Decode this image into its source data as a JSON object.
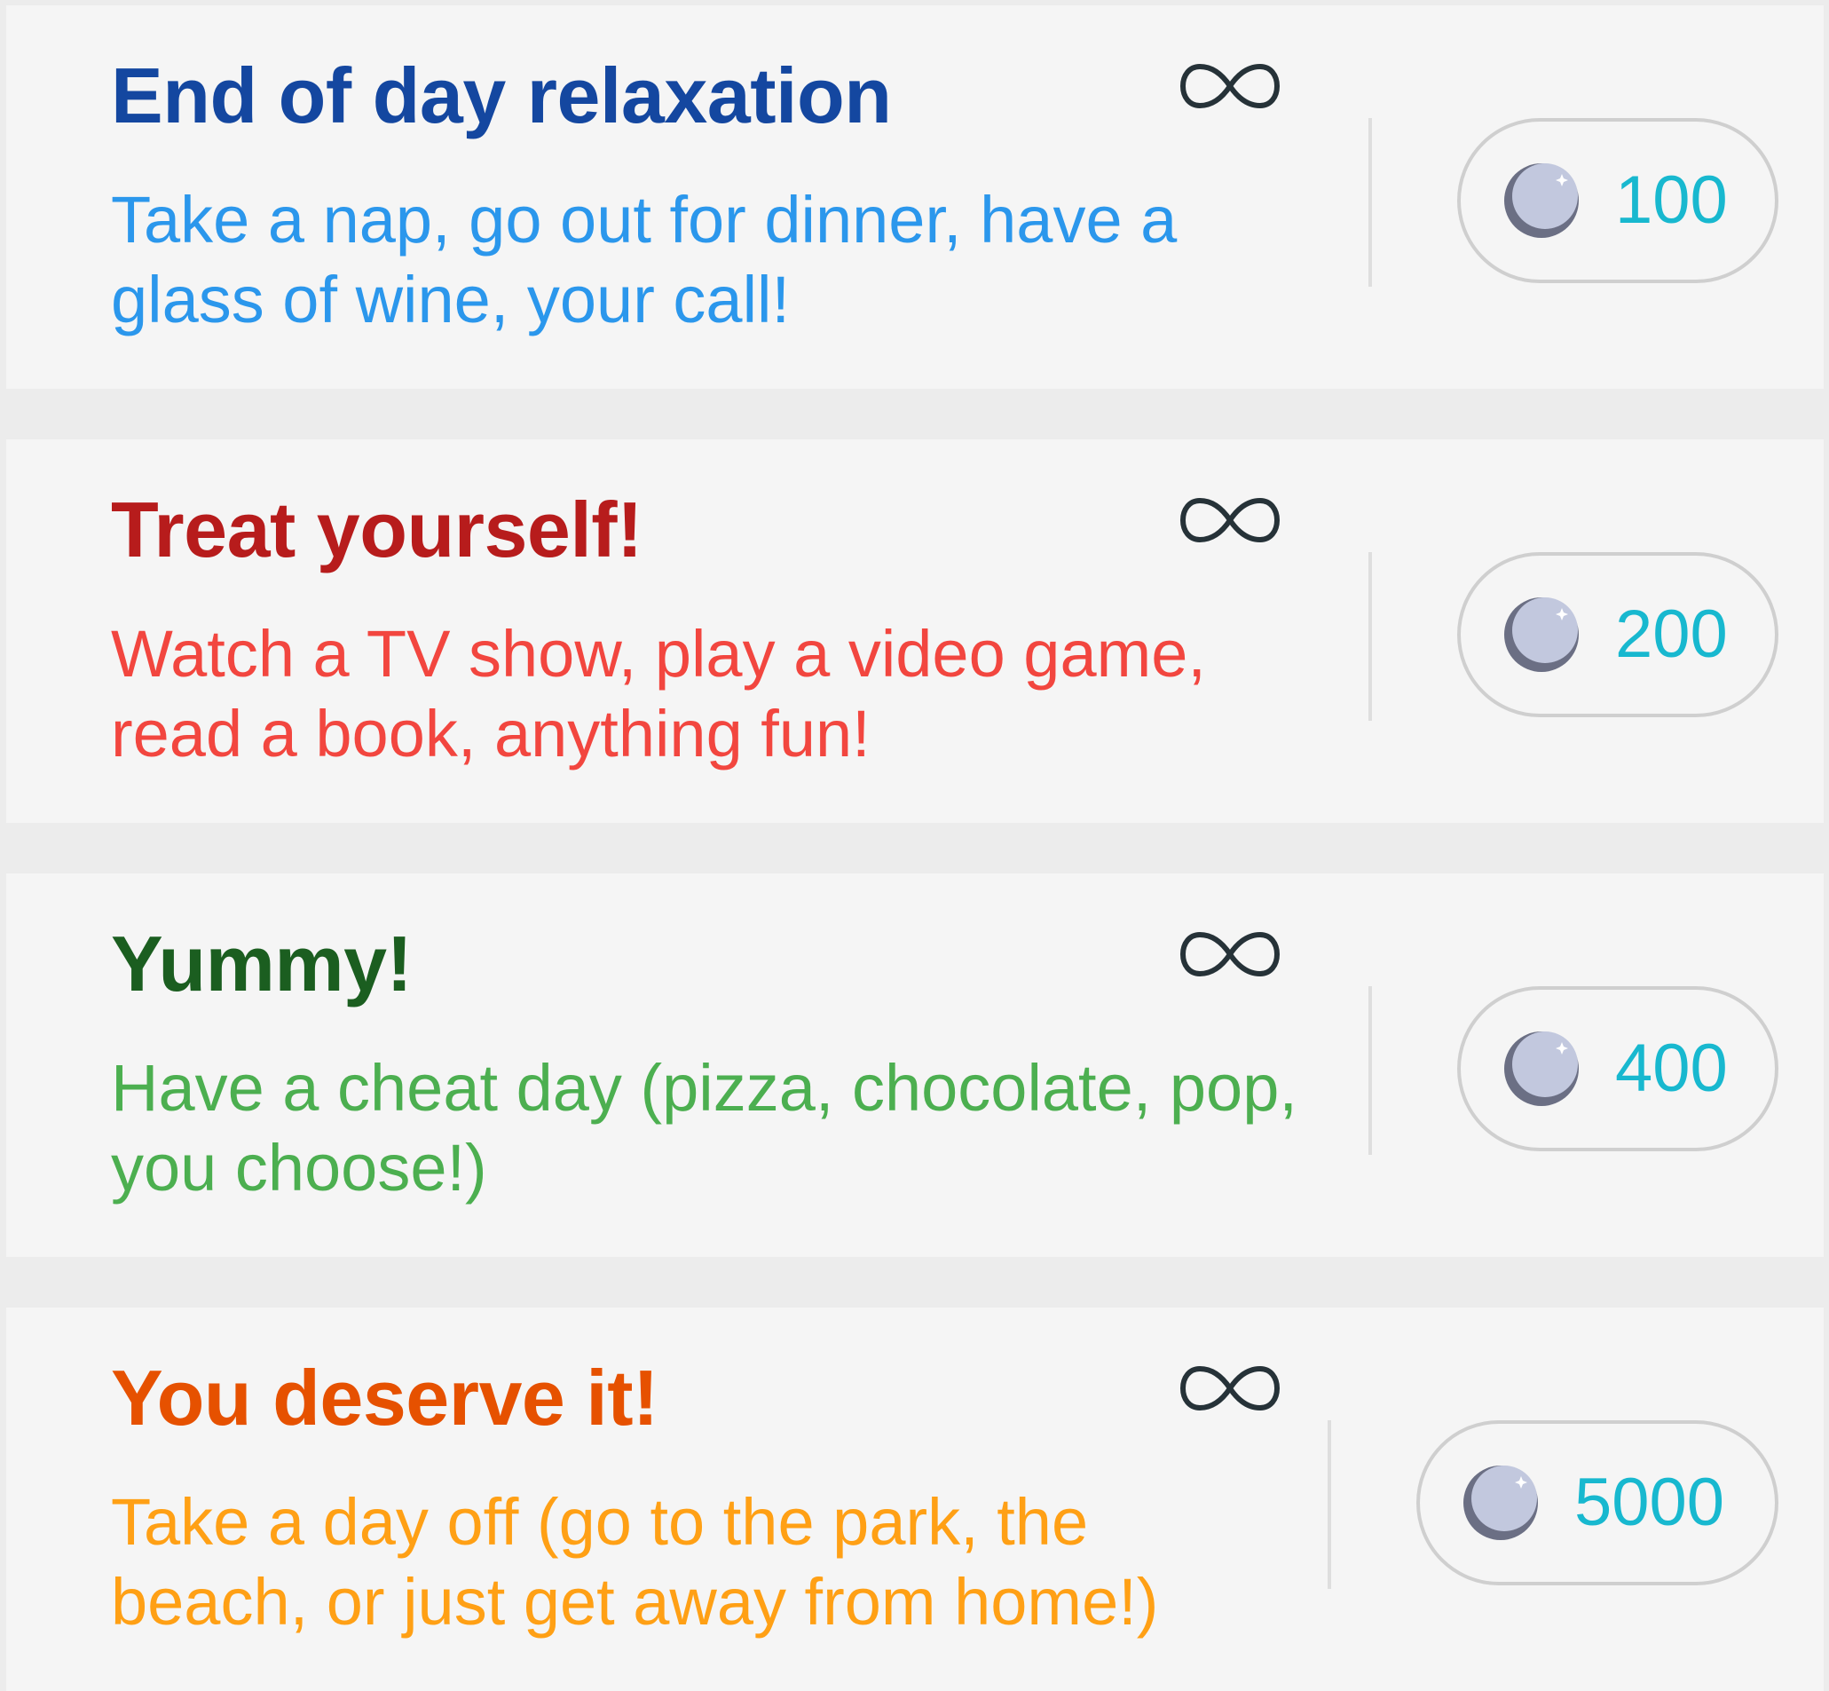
{
  "rewards": [
    {
      "title": "End of day relaxation",
      "description": "Take a nap, go out for dinner, have a glass of wine, your call!",
      "cost": "100",
      "title_color": "#1447a0",
      "desc_color": "#2b97ec",
      "repeat_icon": "infinity-icon"
    },
    {
      "title": "Treat yourself!",
      "description": "Watch a TV show, play a video game, read a book, anything fun!",
      "cost": "200",
      "title_color": "#b71c1c",
      "desc_color": "#f2463f",
      "repeat_icon": "infinity-icon"
    },
    {
      "title": "Yummy!",
      "description": "Have a cheat day (pizza, chocolate, pop, you choose!)",
      "cost": "400",
      "title_color": "#1b5e20",
      "desc_color": "#4caf50",
      "repeat_icon": "infinity-icon"
    },
    {
      "title": "You deserve it!",
      "description": "Take a day off (go to the park, the beach, or just get away from home!)",
      "cost": "5000",
      "title_color": "#e65100",
      "desc_color": "#ffa015",
      "repeat_icon": "infinity-icon"
    }
  ],
  "cost_color": "#18b8cf",
  "coin_icon": "coin-icon"
}
